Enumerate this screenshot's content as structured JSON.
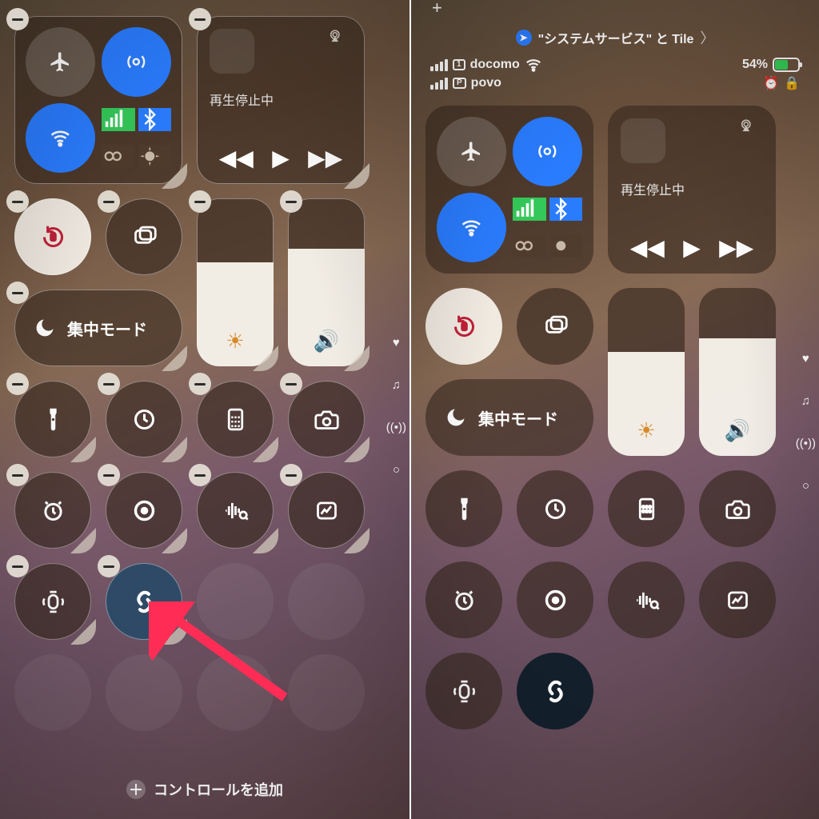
{
  "status": {
    "location_text": "\"システムサービス\" と Tile",
    "carrier1": "docomo",
    "sim1": "1",
    "carrier2": "povo",
    "sim2": "P",
    "battery_label": "54%",
    "battery_pct": 54
  },
  "media": {
    "label": "再生停止中"
  },
  "focus": {
    "label": "集中モード"
  },
  "brightness_pct": 62,
  "volume_pct": 70,
  "add_controls": "コントロールを追加",
  "icons": {
    "airplane": "airplane",
    "airdrop": "airdrop",
    "wifi": "wifi",
    "cellular": "cellular",
    "bluetooth": "bluetooth",
    "hotspot": "hotspot",
    "satellite": "satellite",
    "airplay": "airplay",
    "rewind": "rewind",
    "play": "play",
    "forward": "forward",
    "lock": "rotation-lock",
    "mirror": "screen-mirroring",
    "moon": "moon",
    "sun": "sun",
    "speaker": "speaker",
    "flash": "flashlight",
    "timer": "timer",
    "calc": "calculator",
    "camera": "camera",
    "alarm": "alarm",
    "record": "screen-record",
    "sound": "sound-recognition",
    "stocks": "stocks",
    "watch": "ping-watch",
    "shazam": "shazam",
    "heart": "favorites",
    "music": "music",
    "hotspot_ind": "hotspot",
    "circle": "page"
  }
}
